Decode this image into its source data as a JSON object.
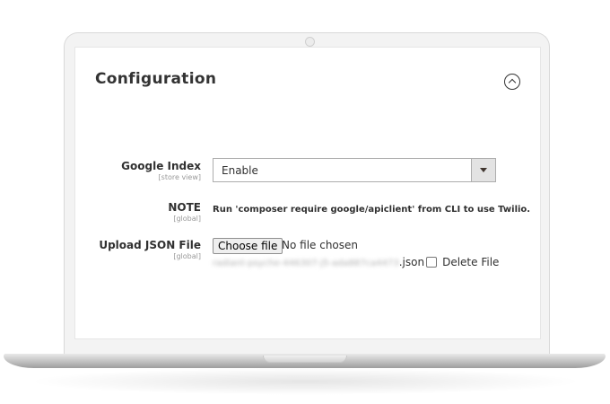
{
  "panel": {
    "title": "Configuration"
  },
  "fields": {
    "google_index": {
      "label": "Google Index",
      "scope": "[store view]",
      "value": "Enable"
    },
    "note": {
      "label": "NOTE",
      "scope": "[global]",
      "text": "Run 'composer require google/apiclient' from CLI to use Twilio."
    },
    "upload_json": {
      "label": "Upload JSON File",
      "scope": "[global]",
      "button_label": "Choose file",
      "status": "No file chosen",
      "filename_blurred": "radiant-psyche-446307-j5-ada887ca4473",
      "filename_ext": ".json",
      "delete_label": "Delete File"
    }
  },
  "icons": {
    "collapse": "chevron-up-circle-icon",
    "select_arrow": "caret-down-icon"
  },
  "colors": {
    "text": "#303030",
    "scope": "#999999",
    "border": "#adadad"
  }
}
